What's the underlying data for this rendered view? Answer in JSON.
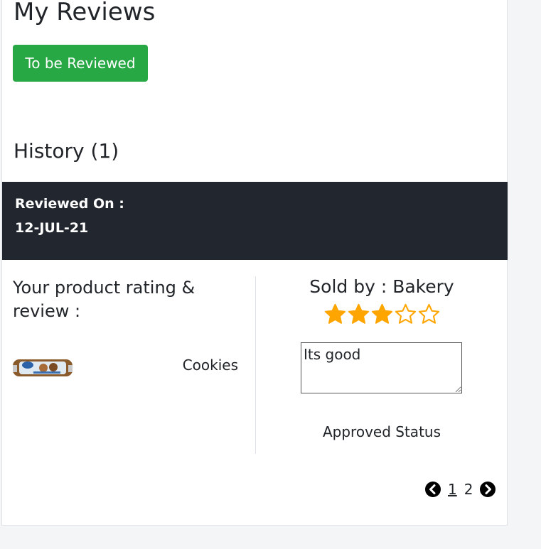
{
  "header": {
    "title": "My Reviews",
    "to_review_button": "To be Reviewed"
  },
  "history": {
    "title": "History (1)",
    "reviewed_on_label": "Reviewed On :",
    "reviewed_on_date": "12-JUL-21"
  },
  "review": {
    "rating_heading": "Your product rating & review :",
    "product_name": "Cookies",
    "sold_by": "Sold by : Bakery",
    "rating": 3,
    "rating_max": 5,
    "review_text": "Its good",
    "status": "Approved Status"
  },
  "pagination": {
    "pages": [
      "1",
      "2"
    ],
    "current": "1"
  },
  "colors": {
    "accent_green": "#28a745",
    "dark_bar": "#22262e",
    "star": "#ffa500"
  },
  "icons": {
    "prev": "chevron-left-circle-icon",
    "next": "chevron-right-circle-icon",
    "star": "star-icon"
  }
}
